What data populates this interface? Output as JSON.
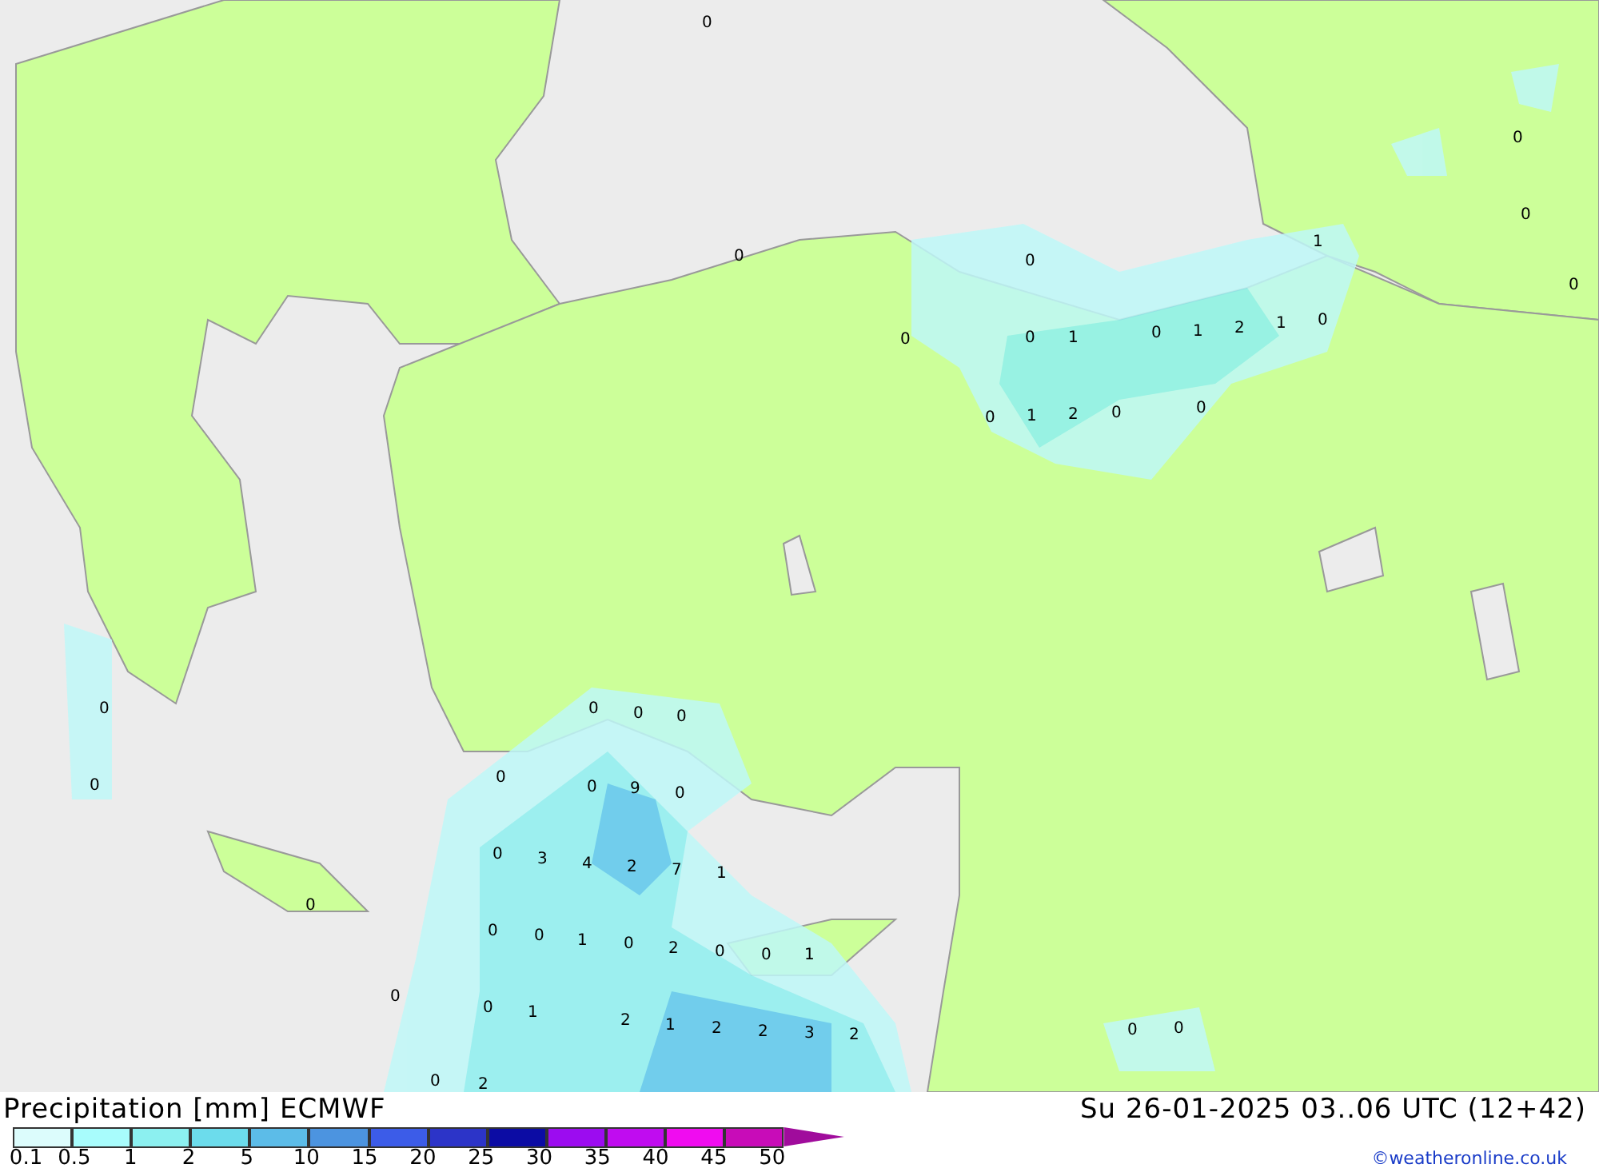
{
  "map": {
    "labels": [
      "0",
      "0",
      "0",
      "0",
      "1",
      "0",
      "0",
      "0",
      "0",
      "1",
      "0",
      "1",
      "2",
      "1",
      "0",
      "0",
      "1",
      "2",
      "0",
      "0",
      "0",
      "0",
      "0",
      "0",
      "0",
      "0",
      "0",
      "9",
      "0",
      "0",
      "3",
      "4",
      "2",
      "7",
      "1",
      "0",
      "0",
      "0",
      "1",
      "0",
      "2",
      "0",
      "0",
      "1",
      "0",
      "0",
      "1",
      "2",
      "1",
      "2",
      "2",
      "3",
      "2",
      "0",
      "0",
      "0",
      "2"
    ]
  },
  "title": "Precipitation [mm] ECMWF",
  "valid_time": "Su 26-01-2025 03..06 UTC (12+42)",
  "legend": {
    "bins": [
      {
        "color": "#dcfcfc"
      },
      {
        "color": "#a8fcfc"
      },
      {
        "color": "#8cf0f0"
      },
      {
        "color": "#6cdcec"
      },
      {
        "color": "#5cbce8"
      },
      {
        "color": "#4c94e0"
      },
      {
        "color": "#3c5ce8"
      },
      {
        "color": "#2c34c8"
      },
      {
        "color": "#0c0ca4"
      },
      {
        "color": "#9c0cf0"
      },
      {
        "color": "#c00cf0"
      },
      {
        "color": "#f00cf0"
      },
      {
        "color": "#c80cb8"
      }
    ],
    "arrow": {
      "color": "#a00c9c"
    },
    "ticks": [
      "0.1",
      "0.5",
      "1",
      "2",
      "5",
      "10",
      "15",
      "20",
      "25",
      "30",
      "35",
      "40",
      "45",
      "50"
    ]
  },
  "credit": "©weatheronline.co.uk"
}
